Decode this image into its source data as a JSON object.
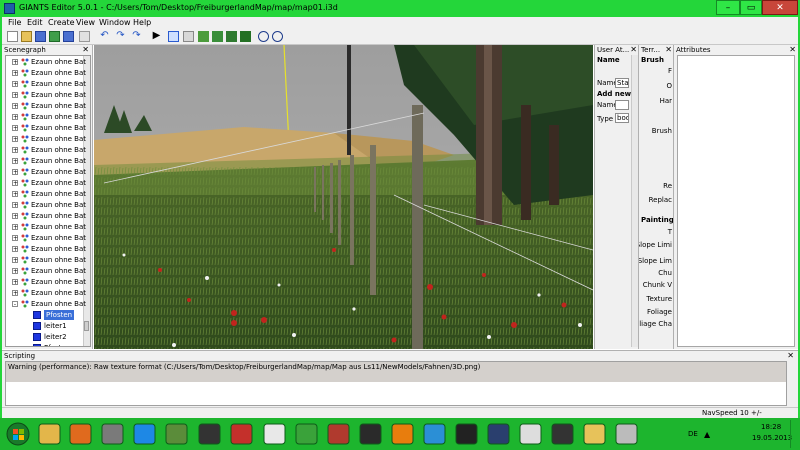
{
  "window": {
    "title": "GIANTS Editor 5.0.1 - C:/Users/Tom/Desktop/FreiburgerlandMap/map/map01.i3d"
  },
  "menu": [
    "File",
    "Edit",
    "Create",
    "View",
    "Window",
    "Help"
  ],
  "scenegraph": {
    "title": "Scenegraph",
    "items": [
      {
        "label": "Ezaun ohne Bat",
        "expand": "+"
      },
      {
        "label": "Ezaun ohne Bat",
        "expand": "+"
      },
      {
        "label": "Ezaun ohne Bat",
        "expand": "+"
      },
      {
        "label": "Ezaun ohne Bat",
        "expand": "+"
      },
      {
        "label": "Ezaun ohne Bat",
        "expand": "+"
      },
      {
        "label": "Ezaun ohne Bat",
        "expand": "+"
      },
      {
        "label": "Ezaun ohne Bat",
        "expand": "+"
      },
      {
        "label": "Ezaun ohne Bat",
        "expand": "+"
      },
      {
        "label": "Ezaun ohne Bat",
        "expand": "+"
      },
      {
        "label": "Ezaun ohne Bat",
        "expand": "+"
      },
      {
        "label": "Ezaun ohne Bat",
        "expand": "+"
      },
      {
        "label": "Ezaun ohne Bat",
        "expand": "+"
      },
      {
        "label": "Ezaun ohne Bat",
        "expand": "+"
      },
      {
        "label": "Ezaun ohne Bat",
        "expand": "+"
      },
      {
        "label": "Ezaun ohne Bat",
        "expand": "+"
      },
      {
        "label": "Ezaun ohne Bat",
        "expand": "+"
      },
      {
        "label": "Ezaun ohne Bat",
        "expand": "+"
      },
      {
        "label": "Ezaun ohne Bat",
        "expand": "+"
      },
      {
        "label": "Ezaun ohne Bat",
        "expand": "+"
      },
      {
        "label": "Ezaun ohne Bat",
        "expand": "+"
      },
      {
        "label": "Ezaun ohne Bat",
        "expand": "+"
      },
      {
        "label": "Ezaun ohne Bat",
        "expand": "+"
      },
      {
        "label": "Ezaun ohne Bat",
        "expand": "-"
      }
    ],
    "children": [
      "Pfosten",
      "leiter1",
      "leiter2",
      "Pfosten"
    ],
    "last_item": "Ezaun ohne Bat"
  },
  "user_attributes": {
    "title": "User At...",
    "name_heading": "Name",
    "name_label": "Name",
    "name_value": "Sta",
    "add_new_heading": "Add new a",
    "new_name_label": "Name",
    "type_label": "Type",
    "type_value": "bool"
  },
  "terrain": {
    "title": "Terr...",
    "brush_heading": "Brush",
    "labels": [
      "F",
      "O",
      "Har",
      "Brush",
      "Re",
      "Replac"
    ],
    "painting_heading": "Painting",
    "painting_labels": [
      "T",
      "Slope Limi",
      "Slope Lim",
      "Chu",
      "Chunk V",
      "Texture",
      "Foliage",
      "Foliage Cha"
    ]
  },
  "attributes": {
    "title": "Attributes"
  },
  "scripting": {
    "title": "Scripting",
    "message": "Warning (performance): Raw texture format (C:/Users/Tom/Desktop/FreiburgerlandMap/map/Map aus Ls11/NewModels/Fahnen/3D.png)"
  },
  "status": {
    "navspeed": "NavSpeed 10 +/-"
  },
  "taskbar": {
    "language": "DE",
    "time": "18:28",
    "date": "19.05.2013",
    "icons": [
      "start-orb",
      "explorer",
      "media-player",
      "tools",
      "internet-explorer",
      "minecraft",
      "game-99",
      "giants-2012",
      "chrome",
      "farming-tractor",
      "harvester",
      "steam",
      "blender",
      "giants-editor",
      "game-2",
      "photoshop",
      "paint",
      "steam-tray",
      "folder",
      "giants-app"
    ]
  },
  "colors": {
    "frame": "#24d63a",
    "taskbar": "#1db52e",
    "selection": "#3a6fd8"
  }
}
